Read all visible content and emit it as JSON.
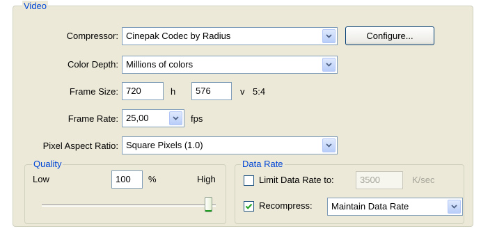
{
  "video": {
    "title": "Video",
    "compressor": {
      "label": "Compressor:",
      "value": "Cinepak Codec by Radius"
    },
    "configure_label": "Configure...",
    "color_depth": {
      "label": "Color Depth:",
      "value": "Millions of colors"
    },
    "frame_size": {
      "label": "Frame Size:",
      "width": "720",
      "h_label": "h",
      "height": "576",
      "v_label": "v",
      "ratio": "5:4"
    },
    "frame_rate": {
      "label": "Frame Rate:",
      "value": "25,00",
      "unit": "fps"
    },
    "pixel_aspect": {
      "label": "Pixel Aspect Ratio:",
      "value": "Square Pixels (1.0)"
    }
  },
  "quality": {
    "title": "Quality",
    "low_label": "Low",
    "value": "100",
    "unit": "%",
    "high_label": "High",
    "slider_level": 1.0
  },
  "data_rate": {
    "title": "Data Rate",
    "limit_label": "Limit Data Rate to:",
    "limit_checked": false,
    "limit_value": "3500",
    "limit_unit": "K/sec",
    "recompress_label": "Recompress:",
    "recompress_checked": true,
    "recompress_value": "Maintain Data Rate"
  },
  "colors": {
    "title_blue": "#0046d5",
    "panel_bg": "#ece9d8",
    "check_green": "#21a121"
  }
}
